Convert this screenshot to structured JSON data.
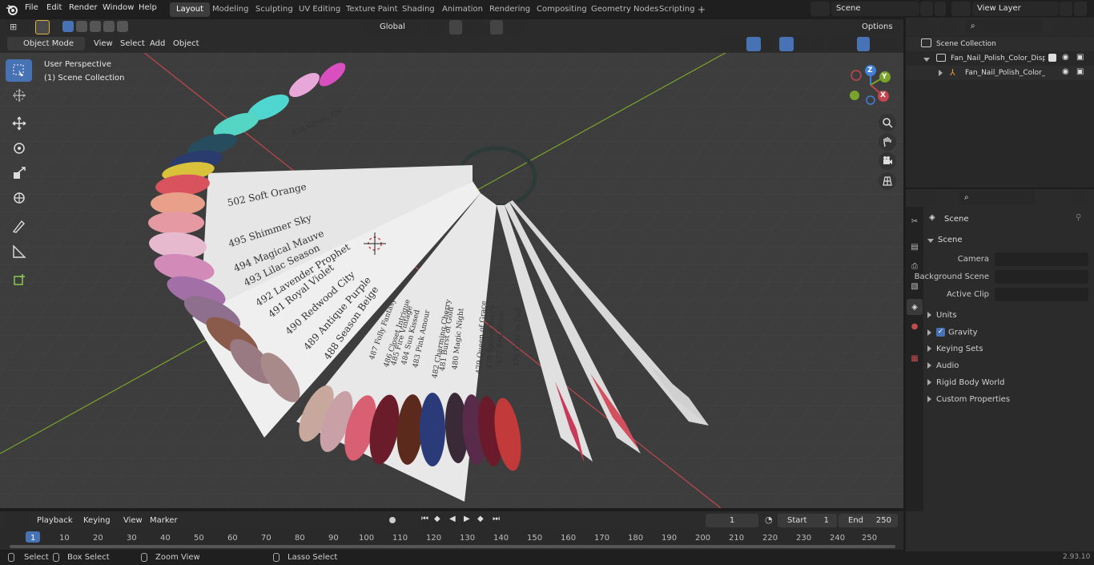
{
  "topbar": {
    "menus": [
      "File",
      "Edit",
      "Render",
      "Window",
      "Help"
    ],
    "workspaces": [
      "Layout",
      "Modeling",
      "Sculpting",
      "UV Editing",
      "Texture Paint",
      "Shading",
      "Animation",
      "Rendering",
      "Compositing",
      "Geometry Nodes",
      "Scripting"
    ],
    "active_workspace": "Layout",
    "add_tab": "+",
    "scene_name": "Scene",
    "view_layer": "View Layer"
  },
  "viewport_header": {
    "mode": "Object Mode",
    "menus": [
      "View",
      "Select",
      "Add",
      "Object"
    ],
    "transform_orientation": "Global",
    "options_label": "Options"
  },
  "viewport": {
    "perspective_label": "User Perspective",
    "collection_label": "(1) Scene Collection",
    "gizmo_axes": [
      "Z",
      "Y",
      "X"
    ],
    "swatch_labels": [
      "533 Green, CN",
      "502 Soft Orange",
      "495 Shimmer Sky",
      "494 Magical Mauve",
      "493 Lilac Season",
      "492 Lavender Prophet",
      "491 Royal Violet",
      "490 Redwood City",
      "489 Antique Purple",
      "488 Season Beige",
      "487 Folly Fantasy",
      "486 Closet Intrigue",
      "485 Fire Vintage",
      "484 Sun Kissed",
      "483 Pink Amour",
      "482 Charming Cherry",
      "481 Burst of Gold",
      "480 Magic Night",
      "479 Queen of Grace",
      "478 Spiced Berry",
      "477 Red Stone",
      "476 Gold in Red"
    ]
  },
  "outliner": {
    "root": "Scene Collection",
    "items": [
      {
        "label": "Fan_Nail_Polish_Color_Display"
      },
      {
        "label": "Fan_Nail_Polish_Color_Di"
      }
    ]
  },
  "properties": {
    "context": "Scene",
    "section": "Scene",
    "fields": [
      {
        "label": "Camera",
        "value": ""
      },
      {
        "label": "Background Scene",
        "value": ""
      },
      {
        "label": "Active Clip",
        "value": ""
      }
    ],
    "panels": [
      "Units",
      "Gravity",
      "Keying Sets",
      "Audio",
      "Rigid Body World",
      "Custom Properties"
    ],
    "gravity_checked": true
  },
  "timeline": {
    "menus": [
      "Playback",
      "Keying",
      "View",
      "Marker"
    ],
    "current_frame": "1",
    "start_label": "Start",
    "start": "1",
    "end_label": "End",
    "end": "250",
    "ticks": [
      "1",
      "10",
      "20",
      "30",
      "40",
      "50",
      "60",
      "70",
      "80",
      "90",
      "100",
      "110",
      "120",
      "130",
      "140",
      "150",
      "160",
      "170",
      "180",
      "190",
      "200",
      "210",
      "220",
      "230",
      "240",
      "250"
    ]
  },
  "statusbar": {
    "select": "Select",
    "box_select": "Box Select",
    "zoom_view": "Zoom View",
    "lasso_select": "Lasso Select",
    "version": "2.93.10"
  },
  "colors": {
    "accent_blue": "#4772b3",
    "x_axis": "#c2464e",
    "y_axis": "#7ba32c",
    "z_axis": "#3f7fd9",
    "viewport_bg": "#3d3d3d"
  }
}
